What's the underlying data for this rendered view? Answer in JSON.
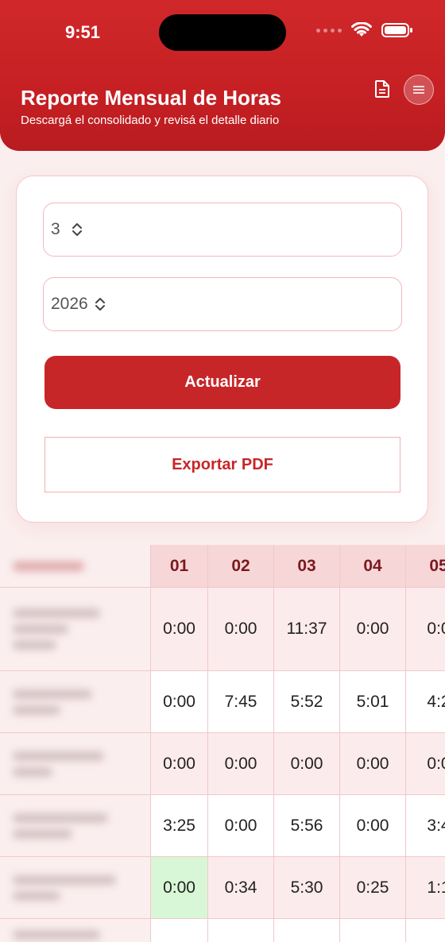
{
  "status": {
    "time": "9:51"
  },
  "header": {
    "title": "Reporte Mensual de Horas",
    "subtitle": "Descargá el consolidado y revisá el detalle diario"
  },
  "form": {
    "month_value": "3",
    "year_value": "2026",
    "update_label": "Actualizar",
    "export_label": "Exportar PDF"
  },
  "table": {
    "days": [
      "01",
      "02",
      "03",
      "04",
      "05"
    ],
    "rows": [
      [
        "0:00",
        "0:00",
        "11:37",
        "0:00",
        "0:0"
      ],
      [
        "0:00",
        "7:45",
        "5:52",
        "5:01",
        "4:2"
      ],
      [
        "0:00",
        "0:00",
        "0:00",
        "0:00",
        "0:0"
      ],
      [
        "3:25",
        "0:00",
        "5:56",
        "0:00",
        "3:4"
      ],
      [
        "0:00",
        "0:34",
        "5:30",
        "0:25",
        "1:1"
      ]
    ]
  },
  "colors": {
    "primary": "#c72628",
    "highlight": "#d8f7d6"
  }
}
